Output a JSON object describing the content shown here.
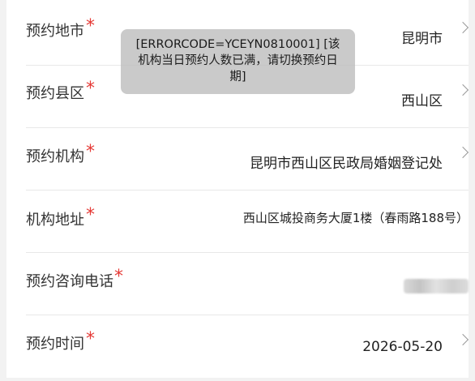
{
  "form": {
    "rows": [
      {
        "label": "预约地市",
        "value": "昆明市",
        "required": "*"
      },
      {
        "label": "预约县区",
        "value": "西山区",
        "required": "*"
      },
      {
        "label": "预约机构",
        "value": "昆明市西山区民政局婚姻登记处",
        "required": "*"
      },
      {
        "label": "机构地址",
        "value": "西山区城投商务大厦1楼（春雨路188号）",
        "required": "*"
      },
      {
        "label": "预约咨询电话",
        "value": "",
        "required": "*"
      },
      {
        "label": "预约时间",
        "value": "2026-05-20",
        "required": "*"
      }
    ]
  },
  "toast": {
    "message": "[ERRORCODE=YCEYN0810001] [该机构当日预约人数已满，请切换预约日期]"
  },
  "colors": {
    "required_star": "#e53935",
    "toast_bg": "#bebebe",
    "page_bg": "#f2f2f2"
  }
}
